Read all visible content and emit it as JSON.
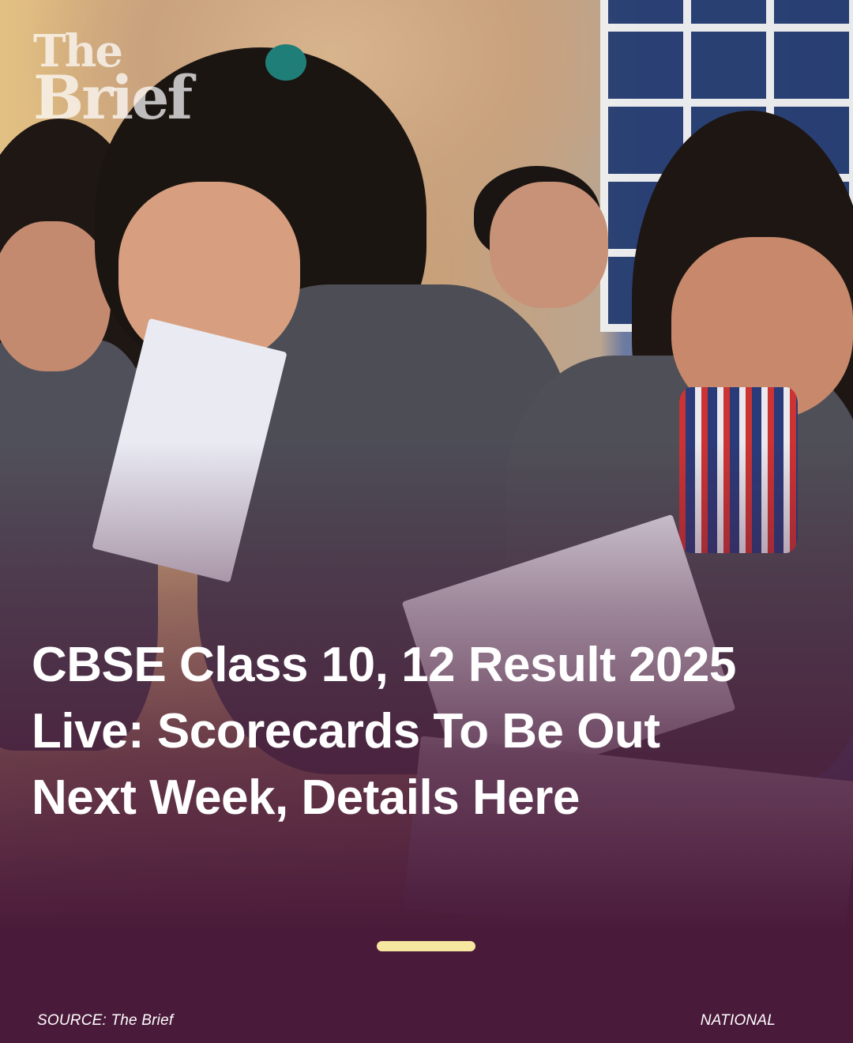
{
  "logo": {
    "line1": "The",
    "line2": "Brief"
  },
  "headline": "CBSE Class 10, 12 Result 2025 Live: Scorecards To Be Out Next Week, Details Here",
  "footer": {
    "source": "SOURCE: The Brief",
    "category": "NATIONAL"
  },
  "colors": {
    "background": "#4a1a3a",
    "accent_bar": "#f6e7a0",
    "text": "#ffffff"
  },
  "image": {
    "subject": "schoolgirls in uniform reading result sheets"
  }
}
